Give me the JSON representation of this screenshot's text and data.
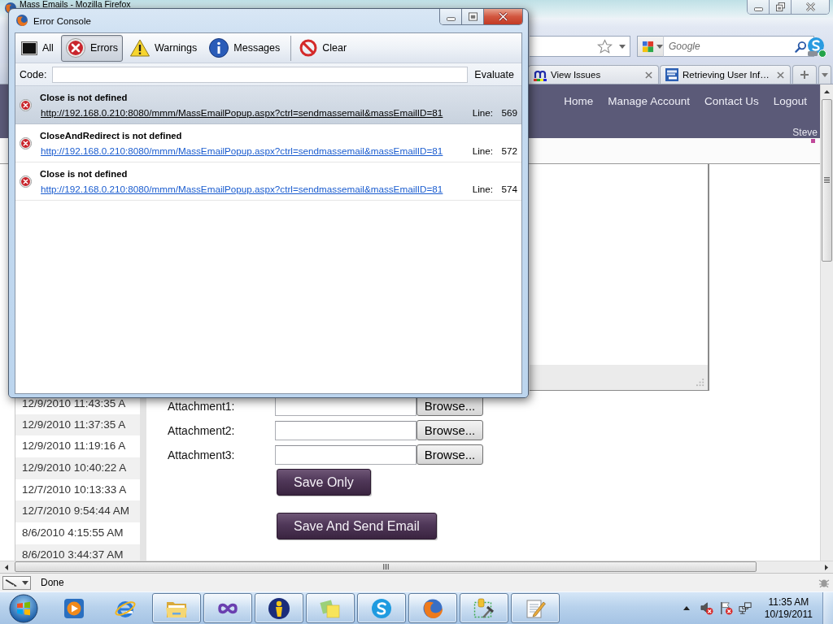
{
  "browser": {
    "title": "Mass Emails - Mozilla Firefox",
    "search": {
      "placeholder": "Google"
    },
    "tabs": [
      {
        "label": "View Issues",
        "kind": "m-logo",
        "selected": false
      },
      {
        "label": "Retrieving User Inf…",
        "kind": "asp-logo",
        "selected": false
      }
    ],
    "page": {
      "nav": [
        "Home",
        "Manage Account",
        "Contact Us",
        "Logout"
      ],
      "user": "Steve",
      "history": [
        "12/9/2010 11:43:35 A",
        "12/9/2010 11:37:35 A",
        "12/9/2010 11:19:16 A",
        "12/9/2010 10:40:22 A",
        "12/7/2010 10:13:33 A",
        "12/7/2010 9:54:44 AM",
        "8/6/2010 4:15:55 AM",
        "8/6/2010 3:44:37 AM"
      ],
      "attachments": [
        {
          "label": "Attachment1:",
          "button": "Browse..."
        },
        {
          "label": "Attachment2:",
          "button": "Browse..."
        },
        {
          "label": "Attachment3:",
          "button": "Browse..."
        }
      ],
      "buttons": [
        "Save Only",
        "Save And Send Email"
      ]
    },
    "status": "Done"
  },
  "error_console": {
    "title": "Error Console",
    "filters": [
      {
        "label": "All",
        "kind": "all",
        "selected": false
      },
      {
        "label": "Errors",
        "kind": "error",
        "selected": true
      },
      {
        "label": "Warnings",
        "kind": "warning",
        "selected": false
      },
      {
        "label": "Messages",
        "kind": "message",
        "selected": false
      }
    ],
    "clear_button": "Clear",
    "code_label": "Code:",
    "evaluate_button": "Evaluate",
    "entries": [
      {
        "message": "Close is not defined",
        "source": "http://192.168.0.210:8080/mmm/MassEmailPopup.aspx?ctrl=sendmassemail&massEmailID=81",
        "line_label": "Line:",
        "line": "569",
        "selected": true
      },
      {
        "message": "CloseAndRedirect is not defined",
        "source": "http://192.168.0.210:8080/mmm/MassEmailPopup.aspx?ctrl=sendmassemail&massEmailID=81",
        "line_label": "Line:",
        "line": "572",
        "selected": false
      },
      {
        "message": "Close is not defined",
        "source": "http://192.168.0.210:8080/mmm/MassEmailPopup.aspx?ctrl=sendmassemail&massEmailID=81",
        "line_label": "Line:",
        "line": "574",
        "selected": false
      }
    ]
  },
  "taskbar": {
    "apps": [
      {
        "kind": "media",
        "running": false
      },
      {
        "kind": "e-browser",
        "running": false
      },
      {
        "kind": "folder",
        "running": true
      },
      {
        "kind": "infinity",
        "running": true
      },
      {
        "kind": "figure",
        "running": true
      },
      {
        "kind": "notes",
        "running": true
      },
      {
        "kind": "chat",
        "running": true
      },
      {
        "kind": "globe",
        "running": true
      },
      {
        "kind": "tools",
        "running": true
      },
      {
        "kind": "notepad",
        "running": true
      }
    ],
    "time": "11:35 AM",
    "date": "10/19/2011"
  }
}
